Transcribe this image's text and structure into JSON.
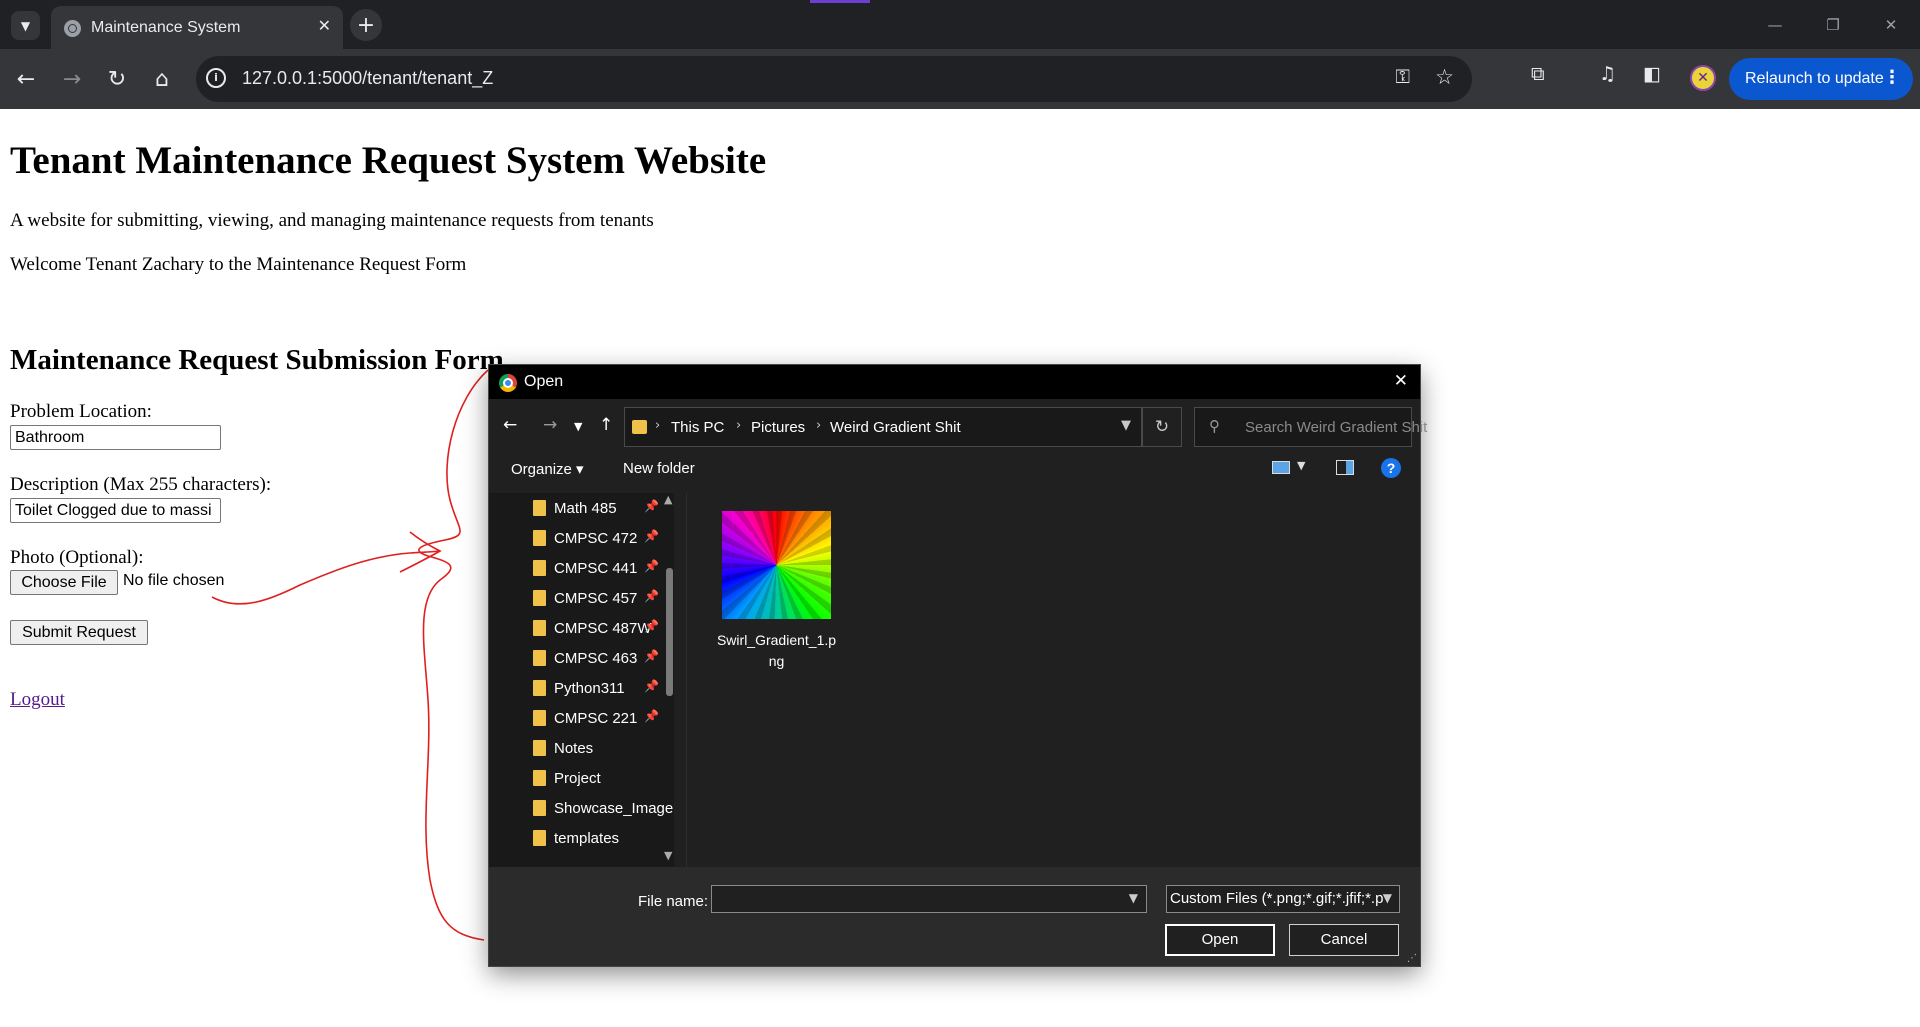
{
  "browser": {
    "tab_search_icon": "chevron-down-icon",
    "tab": {
      "title": "Maintenance System",
      "close": "✕"
    },
    "new_tab": "+",
    "window_controls": {
      "minimize": "—",
      "restore": "❐",
      "close": "✕"
    },
    "nav": {
      "back": "←",
      "forward": "→",
      "reload": "↻",
      "home": "⌂"
    },
    "url": "127.0.0.1:5000/tenant/tenant_Z",
    "relaunch_label": "Relaunch to update",
    "accent_color": "#0b57d0"
  },
  "page": {
    "title": "Tenant Maintenance Request System Website",
    "description": "A website for submitting, viewing, and managing maintenance requests from tenants",
    "welcome": "Welcome Tenant Zachary to the Maintenance Request Form",
    "form": {
      "heading": "Maintenance Request Submission Form",
      "location_label": "Problem Location:",
      "location_value": "Bathroom",
      "description_label": "Description (Max 255 characters):",
      "description_value": "Toilet Clogged due to massi",
      "photo_label": "Photo (Optional):",
      "choose_file_label": "Choose File",
      "no_file_text": "No file chosen",
      "submit_label": "Submit Request"
    },
    "logout_label": "Logout",
    "annotation_color": "#e02020"
  },
  "dialog": {
    "title": "Open",
    "close": "✕",
    "breadcrumb": [
      "This PC",
      "Pictures",
      "Weird Gradient Shit"
    ],
    "search_placeholder": "Search Weird Gradient Shit",
    "organize_label": "Organize ▾",
    "new_folder_label": "New folder",
    "help_label": "?",
    "nav_items": [
      {
        "name": "Math 485",
        "pinned": true
      },
      {
        "name": "CMPSC 472",
        "pinned": true
      },
      {
        "name": "CMPSC 441",
        "pinned": true
      },
      {
        "name": "CMPSC 457",
        "pinned": true
      },
      {
        "name": "CMPSC 487W",
        "pinned": true
      },
      {
        "name": "CMPSC 463",
        "pinned": true
      },
      {
        "name": "Python311",
        "pinned": true
      },
      {
        "name": "CMPSC 221",
        "pinned": true
      },
      {
        "name": "Notes",
        "pinned": false
      },
      {
        "name": "Project",
        "pinned": false
      },
      {
        "name": "Showcase_Image",
        "pinned": false
      },
      {
        "name": "templates",
        "pinned": false
      }
    ],
    "files": [
      {
        "name": "Swirl_Gradient_1.png"
      }
    ],
    "file_name_label": "File name:",
    "file_name_value": "",
    "file_type": "Custom Files (*.png;*.gif;*.jfif;*.p",
    "open_label": "Open",
    "cancel_label": "Cancel"
  }
}
